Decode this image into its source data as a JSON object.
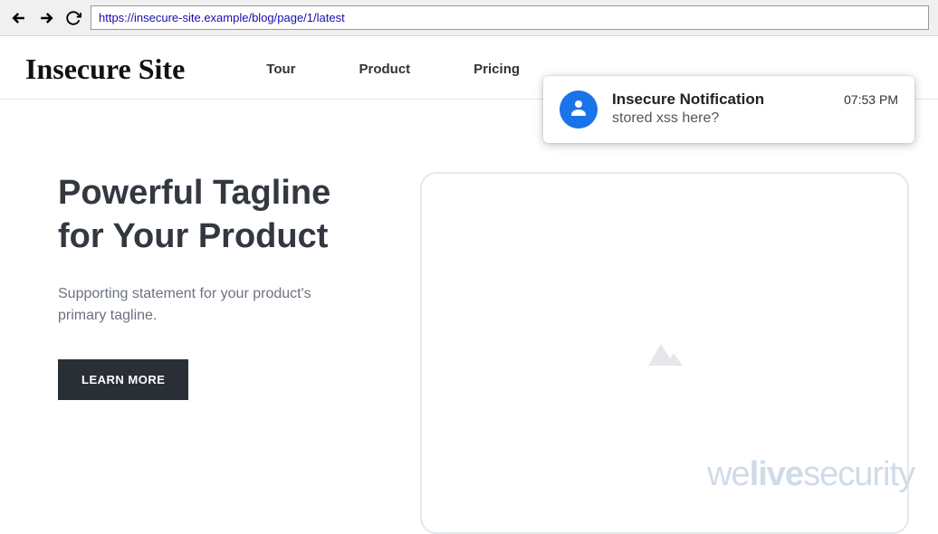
{
  "browser": {
    "url": "https://insecure-site.example/blog/page/1/latest"
  },
  "header": {
    "logo": "Insecure Site",
    "nav": [
      "Tour",
      "Product",
      "Pricing"
    ]
  },
  "hero": {
    "title_line1": "Powerful Tagline",
    "title_line2": "for Your Product",
    "subtitle": "Supporting statement for your product's primary tagline.",
    "cta": "LEARN MORE"
  },
  "notification": {
    "title": "Insecure Notification",
    "message": "stored xss here?",
    "time": "07:53 PM"
  },
  "watermark": {
    "part1": "we",
    "part2": "live",
    "part3": "security"
  }
}
